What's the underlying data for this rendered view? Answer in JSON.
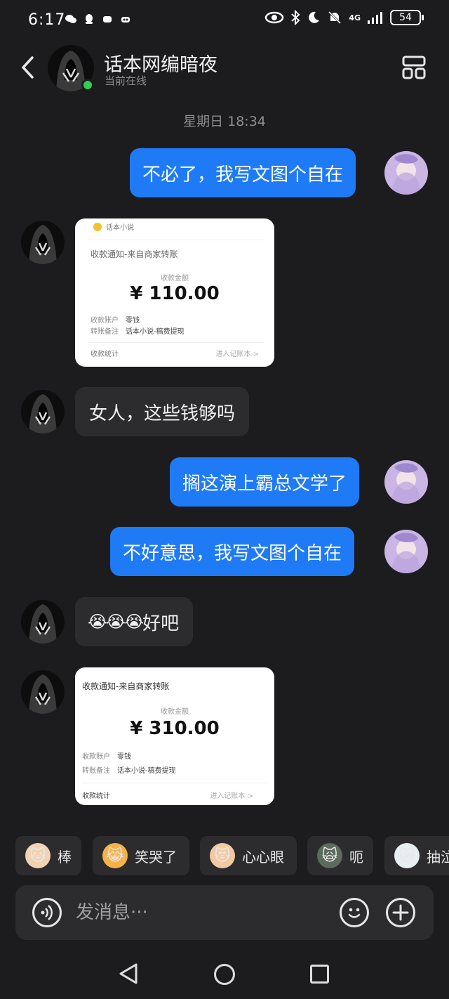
{
  "status_bar": {
    "time": "6:17",
    "network": "4G",
    "battery": "54"
  },
  "header": {
    "contact_name": "话本网编暗夜",
    "contact_status": "当前在线",
    "back_icon": "chevron-left-icon",
    "layout_icon": "layout-grid-icon"
  },
  "timestamp": "星期日 18:34",
  "messages": [
    {
      "side": "out",
      "text": "不必了，我写文图个自在"
    },
    {
      "side": "in",
      "type": "image",
      "receipt": {
        "brand": "话本小说",
        "title": "收款通知-来自商家转账",
        "amount_label": "收款金额",
        "amount": "¥ 110.00",
        "account_label": "收款账户",
        "account_value": "零钱",
        "note_label": "转账备注",
        "note_value": "话本小说-稿费提现",
        "footer_left": "收款统计",
        "footer_right": "进入记账本 >"
      }
    },
    {
      "side": "in",
      "text": "女人，这些钱够吗"
    },
    {
      "side": "out",
      "text": "搁这演上霸总文学了"
    },
    {
      "side": "out",
      "text": "不好意思，我写文图个自在"
    },
    {
      "side": "in",
      "text": "好吧",
      "emoji": "😭😭😭"
    },
    {
      "side": "in",
      "type": "image",
      "receipt": {
        "title": "收款通知-来自商家转账",
        "amount_label": "收款金额",
        "amount": "¥ 310.00",
        "account_label": "收款账户",
        "account_value": "零钱",
        "note_label": "转账备注",
        "note_value": "话本小说-稿费提现",
        "footer_left": "收款统计",
        "footer_right": "进入记账本 >"
      }
    }
  ],
  "quick_replies": [
    {
      "label": "棒",
      "emoji": "🐱",
      "color": "#f1d3b4"
    },
    {
      "label": "笑哭了",
      "emoji": "😹",
      "color": "#f6b24a"
    },
    {
      "label": "心心眼",
      "emoji": "😻",
      "color": "#f3c9a3"
    },
    {
      "label": "呃",
      "emoji": "🙀",
      "color": "#5b6b5e"
    },
    {
      "label": "抽泣",
      "emoji": "😿",
      "color": "#e9eef2"
    }
  ],
  "input": {
    "placeholder": "发消息···"
  },
  "colors": {
    "background": "#1c1c1e",
    "outgoing_bubble": "#1f7bf5",
    "incoming_bubble": "#2c2c2e",
    "online": "#2fcf52"
  }
}
